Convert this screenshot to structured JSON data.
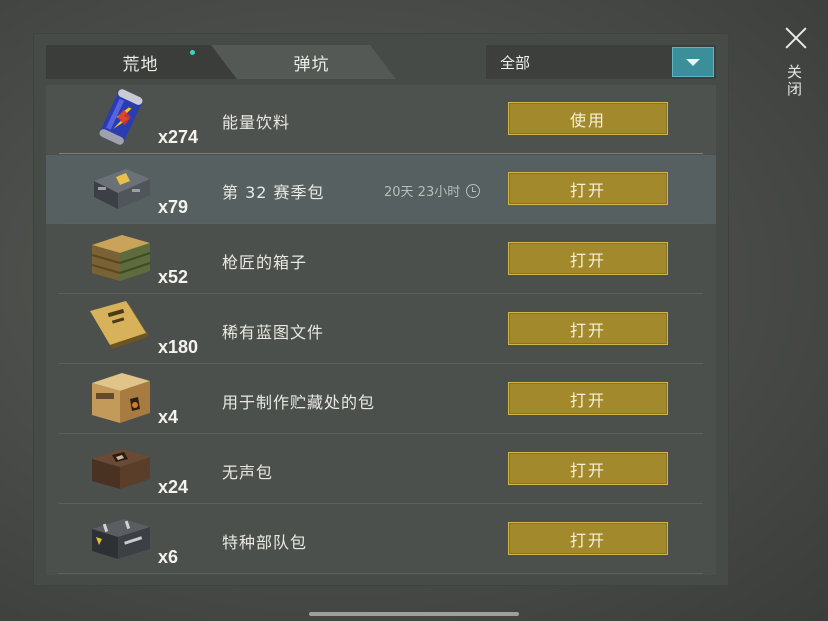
{
  "tabs": [
    {
      "label": "荒地",
      "active": true,
      "has_notification": true
    },
    {
      "label": "弹坑",
      "active": false
    }
  ],
  "filter": {
    "selected": "全部"
  },
  "close": {
    "label": "关闭"
  },
  "items": [
    {
      "icon": "energy-drink-can-icon",
      "quantity": "x274",
      "name": "能量饮料",
      "action": "使用",
      "timer": ""
    },
    {
      "icon": "season-pack-icon",
      "quantity": "x79",
      "name": "第 32 赛季包",
      "action": "打开",
      "timer": "20天 23小时"
    },
    {
      "icon": "gunsmith-crate-icon",
      "quantity": "x52",
      "name": "枪匠的箱子",
      "action": "打开",
      "timer": ""
    },
    {
      "icon": "blueprint-folder-icon",
      "quantity": "x180",
      "name": "稀有蓝图文件",
      "action": "打开",
      "timer": ""
    },
    {
      "icon": "stash-crafting-box-icon",
      "quantity": "x4",
      "name": "用于制作贮藏处的包",
      "action": "打开",
      "timer": ""
    },
    {
      "icon": "silent-pack-icon",
      "quantity": "x24",
      "name": "无声包",
      "action": "打开",
      "timer": ""
    },
    {
      "icon": "special-forces-case-icon",
      "quantity": "x6",
      "name": "特种部队包",
      "action": "打开",
      "timer": ""
    }
  ],
  "colors": {
    "action_button": "#a28a2c",
    "dropdown_accent": "#3b8f9b",
    "notification_dot": "#3fd1c4"
  }
}
